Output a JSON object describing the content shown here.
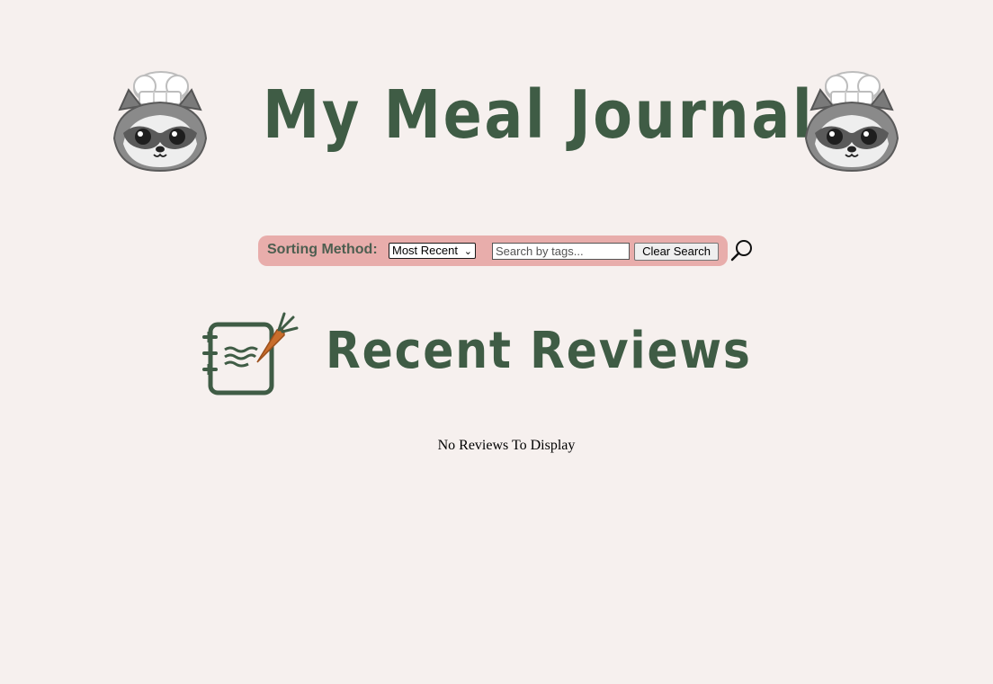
{
  "header": {
    "title": "My Meal Journal",
    "mascot_icon": "raccoon-chef-icon"
  },
  "toolbar": {
    "sort_label": "Sorting Method:",
    "sort_selected": "Most Recent",
    "search_placeholder": "Search by tags...",
    "clear_label": "Clear Search",
    "search_icon": "magnifier-icon"
  },
  "section": {
    "title": "Recent Reviews",
    "icon": "notebook-carrot-icon",
    "empty_message": "No Reviews To Display"
  },
  "colors": {
    "background": "#f6f0ee",
    "brand_green": "#3f5c45",
    "toolbar_pink": "#e8adab",
    "carrot_orange": "#c96d2c"
  }
}
